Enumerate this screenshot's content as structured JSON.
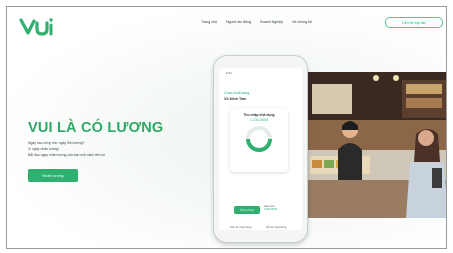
{
  "colors": {
    "brand_green": "#2fb070",
    "title_green": "#2ea866",
    "text_dark": "#2e3b36"
  },
  "header": {
    "logo_text": "Vui",
    "nav": [
      "Trang chủ",
      "Người lao động",
      "Doanh Nghiệp",
      "Về chúng tôi"
    ],
    "cta": "Liên hệ hợp tác"
  },
  "hero": {
    "title": "VUI LÀ CÓ LƯƠNG",
    "lines": [
      "Ngày nào cũng như ngày lĩnh lương?",
      "Vì ngày nhận lương!",
      "Bắt đầu ngay nhận lương của bạn một cách tiện lợi"
    ],
    "button": "Nhận lương"
  },
  "phone": {
    "status_time": "9:41",
    "title": "Chào buổi sáng,",
    "name": "Võ Minh Tâm",
    "card_label": "Thu nhập khả dụng",
    "card_amount": "1.234.000đ",
    "button": "Ứng lương",
    "note_line1": "Hạn mức",
    "note_line2": "5.000.000đ",
    "row1": "Lịch sử\nứng lương",
    "row2": "Hỗ trợ\nứng lương",
    "icons": [
      "wallet-icon",
      "bell-icon",
      "user-icon"
    ]
  }
}
